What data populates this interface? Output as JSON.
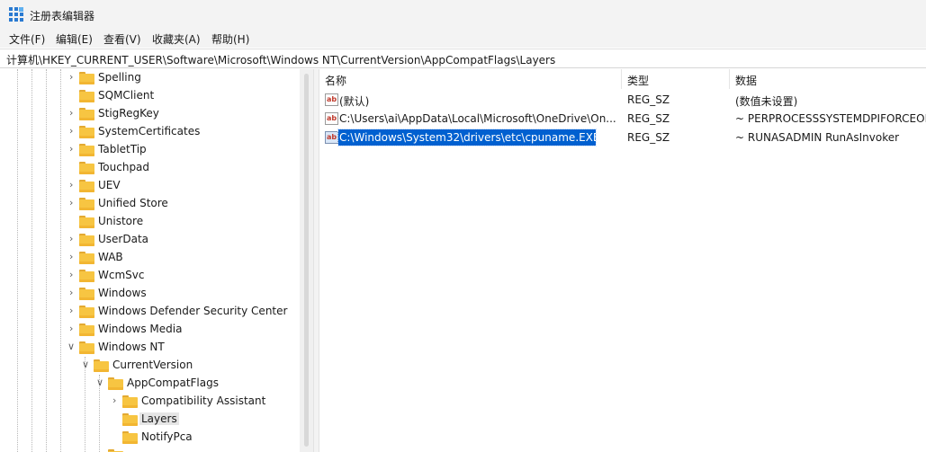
{
  "window": {
    "title": "注册表编辑器"
  },
  "menu": [
    "文件(F)",
    "编辑(E)",
    "查看(V)",
    "收藏夹(A)",
    "帮助(H)"
  ],
  "address": "计算机\\HKEY_CURRENT_USER\\Software\\Microsoft\\Windows NT\\CurrentVersion\\AppCompatFlags\\Layers",
  "tree": {
    "nodes": [
      {
        "label": "Spelling",
        "chevron": "right"
      },
      {
        "label": "SQMClient",
        "chevron": "none"
      },
      {
        "label": "StigRegKey",
        "chevron": "right"
      },
      {
        "label": "SystemCertificates",
        "chevron": "right"
      },
      {
        "label": "TabletTip",
        "chevron": "right"
      },
      {
        "label": "Touchpad",
        "chevron": "none"
      },
      {
        "label": "UEV",
        "chevron": "right"
      },
      {
        "label": "Unified Store",
        "chevron": "right"
      },
      {
        "label": "Unistore",
        "chevron": "none"
      },
      {
        "label": "UserData",
        "chevron": "right"
      },
      {
        "label": "WAB",
        "chevron": "right"
      },
      {
        "label": "WcmSvc",
        "chevron": "right"
      },
      {
        "label": "Windows",
        "chevron": "right"
      },
      {
        "label": "Windows Defender Security Center",
        "chevron": "right"
      },
      {
        "label": "Windows Media",
        "chevron": "right"
      },
      {
        "label": "Windows NT",
        "chevron": "down"
      },
      {
        "label": "CurrentVersion",
        "chevron": "down"
      },
      {
        "label": "AppCompatFlags",
        "chevron": "down"
      },
      {
        "label": "Compatibility Assistant",
        "chevron": "right"
      },
      {
        "label": "Layers",
        "chevron": "none",
        "selected": true
      },
      {
        "label": "NotifyPca",
        "chevron": "none"
      }
    ]
  },
  "values": {
    "headers": {
      "name": "名称",
      "type": "类型",
      "data": "数据"
    },
    "rows": [
      {
        "name": "(默认)",
        "type": "REG_SZ",
        "data": "(数值未设置)",
        "selected": false
      },
      {
        "name": "C:\\Users\\ai\\AppData\\Local\\Microsoft\\OneDrive\\On...",
        "type": "REG_SZ",
        "data": "~ PERPROCESSSYSTEMDPIFORCEOFF",
        "selected": false
      },
      {
        "name": "C:\\Windows\\System32\\drivers\\etc\\cpuname.EXE",
        "type": "REG_SZ",
        "data": "~ RUNASADMIN RunAsInvoker",
        "selected": true
      }
    ]
  },
  "icons": {
    "app": "registry-editor-icon",
    "value": "string-value-icon",
    "folder": "folder-icon"
  },
  "colors": {
    "selection": "#0060d0",
    "folder": "#f7c542",
    "tree_selected": "#e5e5e5"
  }
}
